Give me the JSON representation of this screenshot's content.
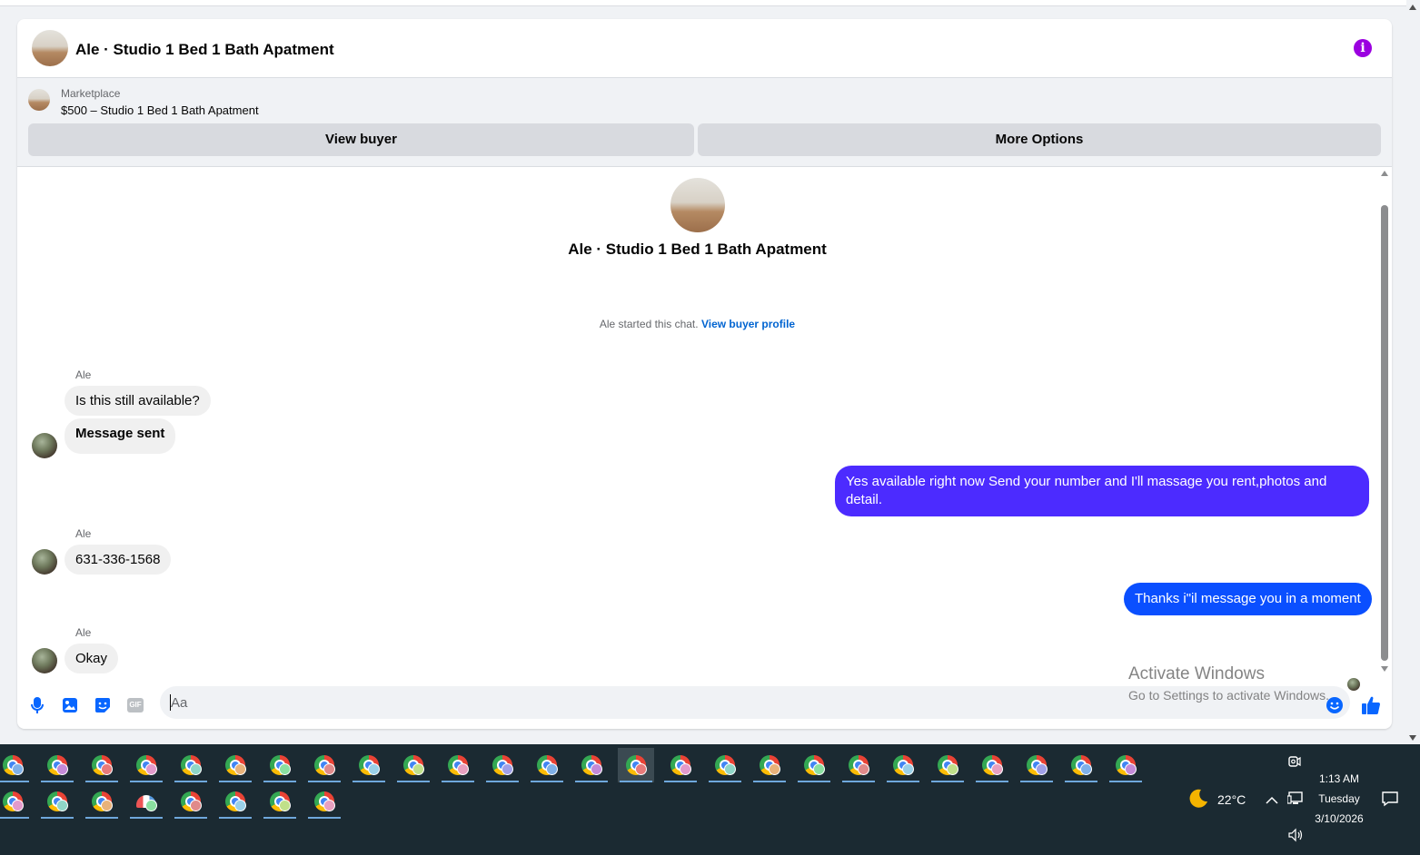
{
  "header": {
    "title": "Ale · Studio 1 Bed 1 Bath Apatment",
    "info_icon": "info-icon",
    "info_color": "#9b00e0"
  },
  "listing": {
    "label": "Marketplace",
    "item": "$500 – Studio 1 Bed 1 Bath Apatment",
    "view_buyer_label": "View buyer",
    "more_options_label": "More Options"
  },
  "chat": {
    "title": "Ale · Studio 1 Bed 1 Bath Apatment",
    "started_text": "Ale started this chat.",
    "view_profile_link": "View buyer profile",
    "messages": [
      {
        "from": "Ale",
        "sender_label": "Ale",
        "text": "Is this still available?"
      },
      {
        "from": "Ale",
        "text": "Message sent"
      },
      {
        "from": "me",
        "text": "Yes available right now Send your number and I'll massage you rent,photos and detail."
      },
      {
        "from": "Ale",
        "sender_label": "Ale",
        "text": "631-336-1568"
      },
      {
        "from": "me",
        "text": "Thanks i\"il message you in a moment"
      },
      {
        "from": "Ale",
        "sender_label": "Ale",
        "text": "Okay"
      }
    ]
  },
  "composer": {
    "placeholder": "Aa",
    "tools": [
      "microphone-icon",
      "photo-icon",
      "sticker-icon",
      "gif-icon"
    ],
    "gif_label": "GIF",
    "emoji_icon": "emoji-icon",
    "like_icon": "thumbs-up-icon",
    "accent_color": "#0866ff"
  },
  "watermark": {
    "line1": "Activate Windows",
    "line2": "Go to Settings to activate Windows."
  },
  "taskbar": {
    "weather_icon": "moon-icon",
    "temperature": "22°C",
    "time": "1:13 AM",
    "day": "Tuesday",
    "date": "3/10/2026",
    "row1_count": 26,
    "row2_count": 8
  }
}
